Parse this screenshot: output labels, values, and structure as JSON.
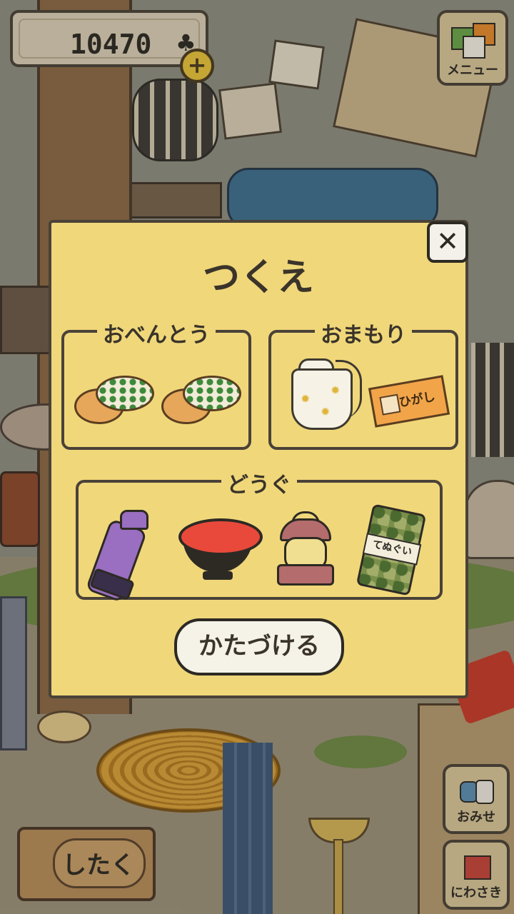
{
  "hud": {
    "clover_count": "10470",
    "clover_symbol": "♣",
    "add_label": "+",
    "menu_label": "メニュー",
    "shop_label": "おみせ",
    "garden_label": "にわさき",
    "prepare_label": "したく"
  },
  "modal": {
    "title": "つくえ",
    "close_label": "✕",
    "bento_label": "おべんとう",
    "omamori_label": "おまもり",
    "tools_label": "どうぐ",
    "ticket_text": "ひがし",
    "mat_band_text": "てぬぐい",
    "cleanup_label": "かたづける"
  },
  "colors": {
    "modal_bg": "#f0d77a",
    "outline": "#4a4238",
    "button_bg": "#f5f2e8"
  }
}
